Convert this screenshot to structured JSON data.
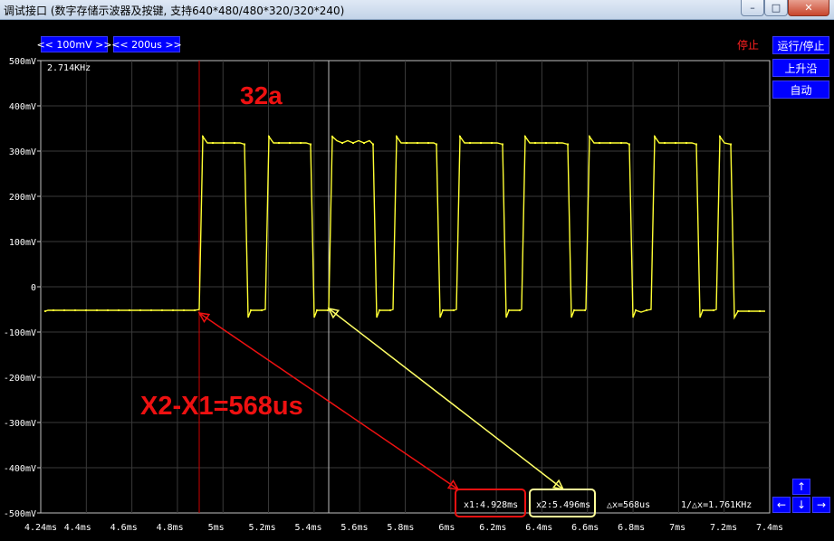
{
  "window": {
    "title": "调试接口 (数字存储示波器及按键, 支持640*480/480*320/320*240)",
    "min_glyph": "–",
    "max_glyph": "□",
    "close_glyph": "✕"
  },
  "controls": {
    "volt_div": "<< 100mV >>",
    "time_div": "<< 200us >>",
    "status": "停止",
    "run_stop": "运行/停止",
    "edge": "上升沿",
    "mode": "自动",
    "nav_up": "↑",
    "nav_left": "←",
    "nav_down": "↓",
    "nav_right": "→"
  },
  "scope": {
    "frequency": "2.714KHz",
    "y_labels": [
      "500mV",
      "400mV",
      "300mV",
      "200mV",
      "100mV",
      "0",
      "-100mV",
      "-200mV",
      "-300mV",
      "-400mV",
      "-500mV"
    ],
    "x_labels": [
      "4.24ms",
      "4.4ms",
      "4.6ms",
      "4.8ms",
      "5ms",
      "5.2ms",
      "5.4ms",
      "5.6ms",
      "5.8ms",
      "6ms",
      "6.2ms",
      "6.4ms",
      "6.6ms",
      "6.8ms",
      "7ms",
      "7.2ms",
      "7.4ms"
    ],
    "x1_readout": "x1:4.928ms",
    "x2_readout": "x2:5.496ms",
    "dx_readout": "△x=568us",
    "inv_dx_readout": "1/△x=1.761KHz",
    "trace_color": "#ffff33",
    "cursor1_color": "#cc0000",
    "cursor2_color": "#bbbbbb"
  },
  "annotations": {
    "label_top": "32a",
    "label_delta": "X2-X1=568us",
    "arrow_red_color": "#ee1111",
    "arrow_yellow_color": "#ffff66"
  }
}
